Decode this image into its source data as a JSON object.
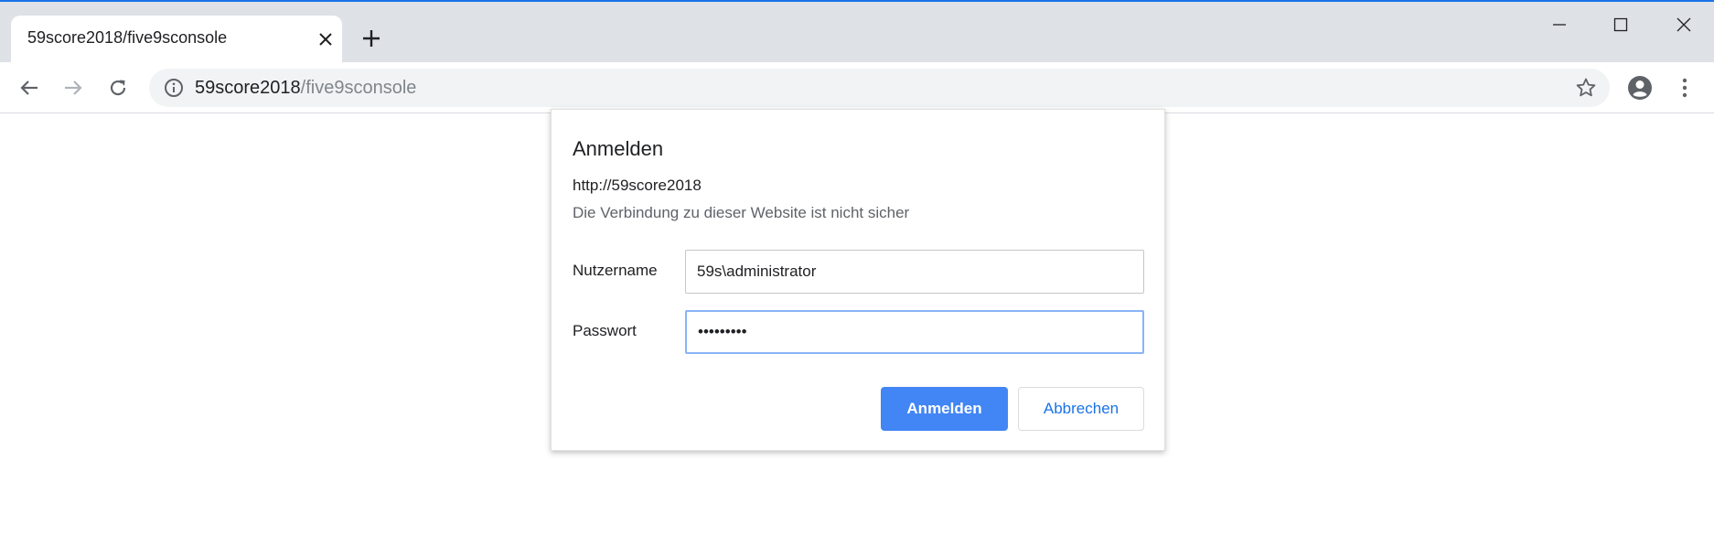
{
  "browser": {
    "tab_title": "59score2018/five9sconsole",
    "url_host": "59score2018",
    "url_path": "/five9sconsole"
  },
  "dialog": {
    "title": "Anmelden",
    "site_url": "http://59score2018",
    "warning": "Die Verbindung zu dieser Website ist nicht sicher",
    "username_label": "Nutzername",
    "username_value": "59s\\administrator",
    "password_label": "Passwort",
    "password_value": "•••••••••",
    "submit_label": "Anmelden",
    "cancel_label": "Abbrechen"
  },
  "icons": {
    "tab_close": "close-icon",
    "new_tab": "plus-icon",
    "minimize": "minimize-icon",
    "maximize": "maximize-icon",
    "close_window": "close-icon",
    "back": "arrow-left-icon",
    "forward": "arrow-right-icon",
    "reload": "reload-icon",
    "site_info": "info-icon",
    "bookmark": "star-icon",
    "profile": "account-icon",
    "menu": "kebab-menu-icon"
  },
  "colors": {
    "accent": "#1a73e8",
    "primary_button": "#4285f4",
    "focus_ring": "#8ab4f8"
  }
}
